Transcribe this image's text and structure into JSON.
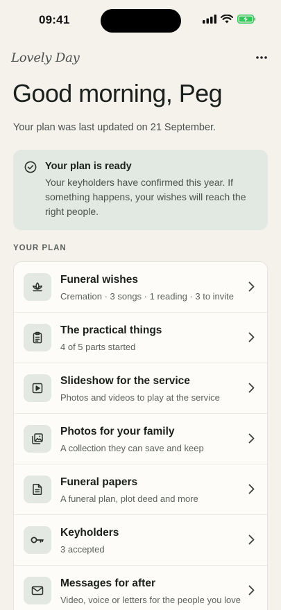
{
  "status_bar": {
    "time": "09:41"
  },
  "header": {
    "brand": "Lovely Day",
    "greeting": "Good morning, Peg",
    "updated_text": "Your plan was last updated on 21 September."
  },
  "ready_card": {
    "title": "Your plan is ready",
    "body": "Your keyholders have confirmed this year. If something happens, your wishes will reach the right people."
  },
  "plan": {
    "section_label": "YOUR PLAN",
    "items": [
      {
        "title": "Funeral wishes",
        "subtitle": "Cremation · 3 songs · 1 reading · 3 to invite",
        "icon": "lotus-icon"
      },
      {
        "title": "The practical things",
        "subtitle": "4 of 5 parts started",
        "icon": "clipboard-icon"
      },
      {
        "title": "Slideshow for the service",
        "subtitle": "Photos and videos to play at the service",
        "icon": "play-icon"
      },
      {
        "title": "Photos for your family",
        "subtitle": "A collection they can save and keep",
        "icon": "photos-icon"
      },
      {
        "title": "Funeral papers",
        "subtitle": "A funeral plan, plot deed and more",
        "icon": "document-icon"
      },
      {
        "title": "Keyholders",
        "subtitle": "3 accepted",
        "icon": "key-icon"
      },
      {
        "title": "Messages for after",
        "subtitle": "Video, voice or letters for the people you love",
        "icon": "envelope-icon"
      }
    ]
  },
  "colors": {
    "background": "#f5f2ec",
    "card_green": "#e2e8e2",
    "battery_green": "#34c759"
  }
}
